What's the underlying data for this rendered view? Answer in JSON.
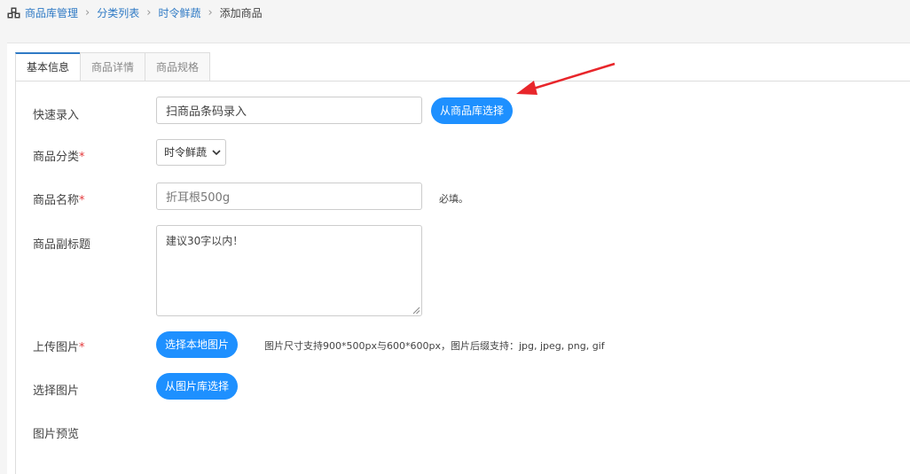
{
  "breadcrumb": {
    "items": [
      "商品库管理",
      "分类列表",
      "时令鲜蔬"
    ],
    "current": "添加商品",
    "icon": "cubes-icon"
  },
  "tabs": [
    {
      "label": "基本信息",
      "active": true
    },
    {
      "label": "商品详情",
      "active": false
    },
    {
      "label": "商品规格",
      "active": false
    }
  ],
  "form": {
    "quick_entry": {
      "label": "快速录入",
      "value": "扫商品条码录入",
      "button": "从商品库选择"
    },
    "category": {
      "label": "商品分类",
      "required_mark": "*",
      "selected": "时令鲜蔬"
    },
    "name": {
      "label": "商品名称",
      "required_mark": "*",
      "value": "折耳根500g",
      "hint": "必填。"
    },
    "subtitle": {
      "label": "商品副标题",
      "value": "建议30字以内！"
    },
    "upload": {
      "label": "上传图片",
      "required_mark": "*",
      "button": "选择本地图片",
      "hint": "图片尺寸支持900*500px与600*600px，图片后缀支持：jpg, jpeg, png, gif"
    },
    "choose": {
      "label": "选择图片",
      "button": "从图片库选择"
    },
    "preview": {
      "label": "图片预览"
    }
  },
  "colors": {
    "accent": "#1e90ff",
    "link": "#2f7ac5",
    "required": "#e4393c",
    "annotation_arrow": "#e8262b"
  }
}
